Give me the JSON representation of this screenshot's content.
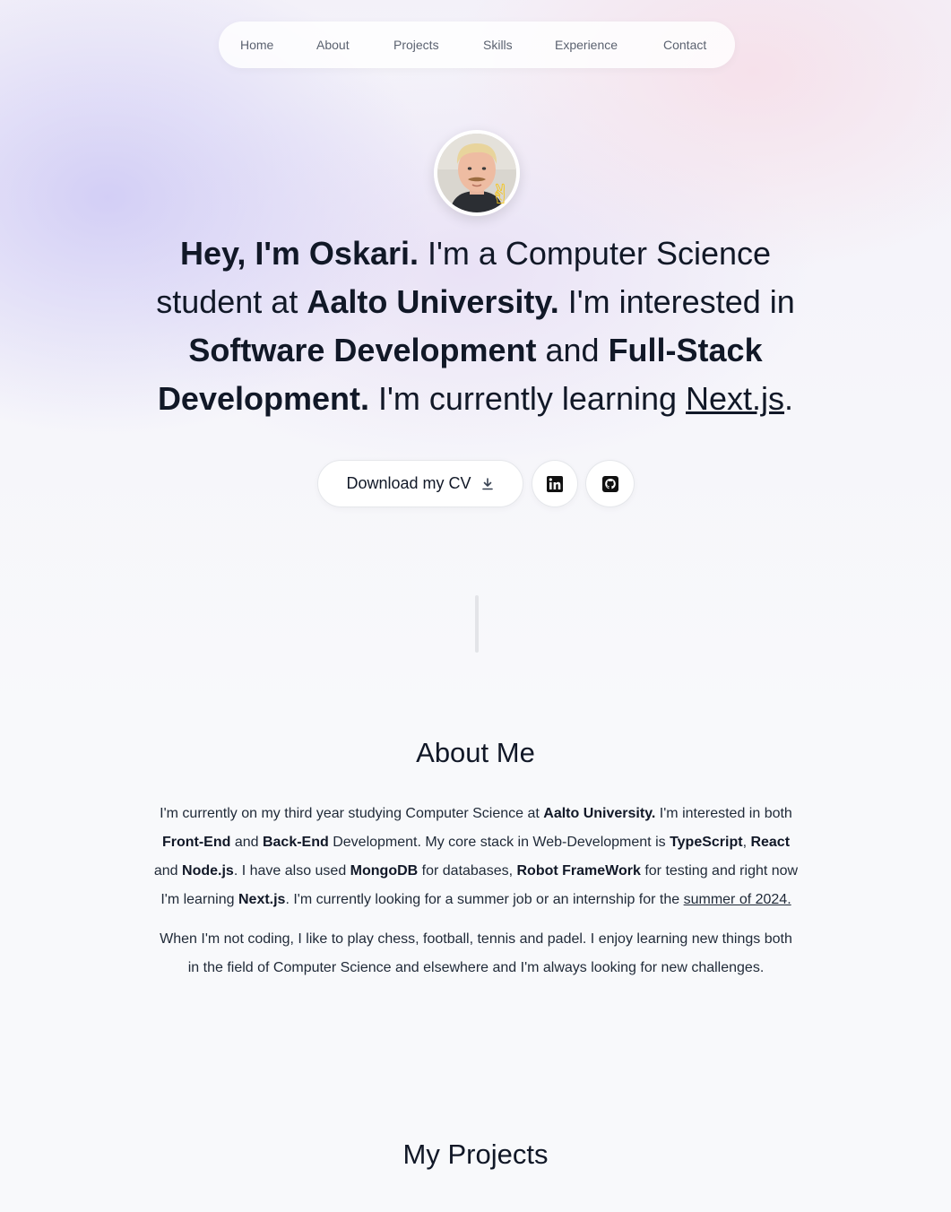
{
  "nav": {
    "items": [
      "Home",
      "About",
      "Projects",
      "Skills",
      "Experience",
      "Contact"
    ]
  },
  "hero": {
    "avatar_icon": "profile-photo",
    "wave_icon": "victory-hand-icon",
    "intro": {
      "greeting": "Hey, I'm Oskari.",
      "p1": " I'm a Computer Science student at ",
      "university": "Aalto University.",
      "p2": " I'm interested in ",
      "interest1": "Software Development",
      "p3": " and ",
      "interest2": "Full-Stack Development.",
      "p4": " I'm currently learning ",
      "learning": "Next.js",
      "p5": "."
    },
    "cv_button_label": "Download my CV",
    "cv_button_icon": "download-icon",
    "linkedin_icon": "linkedin-icon",
    "github_icon": "github-icon"
  },
  "about": {
    "title": "About Me",
    "para1": {
      "t1": "I'm currently on my third year studying Computer Science at ",
      "b1": "Aalto University.",
      "t2": " I'm interested in both ",
      "b2": "Front-End",
      "t3": " and ",
      "b3": "Back-End",
      "t4": " Development. My core stack in Web-Development is ",
      "b4": "TypeScript",
      "t5": ", ",
      "b5": "React",
      "t6": " and ",
      "b6": "Node.js",
      "t7": ". I have also used ",
      "b7": "MongoDB",
      "t8": " for databases, ",
      "b8": "Robot FrameWork",
      "t9": " for testing and right now I'm learning ",
      "b9": "Next.js",
      "t10": ". I'm currently looking for a summer job or an internship for the ",
      "link": "summer of 2024."
    },
    "para2": "When I'm not coding, I like to play chess, football, tennis and padel. I enjoy learning new things both in the field of Computer Science and elsewhere and I'm always looking for new challenges."
  },
  "projects": {
    "title": "My Projects"
  }
}
